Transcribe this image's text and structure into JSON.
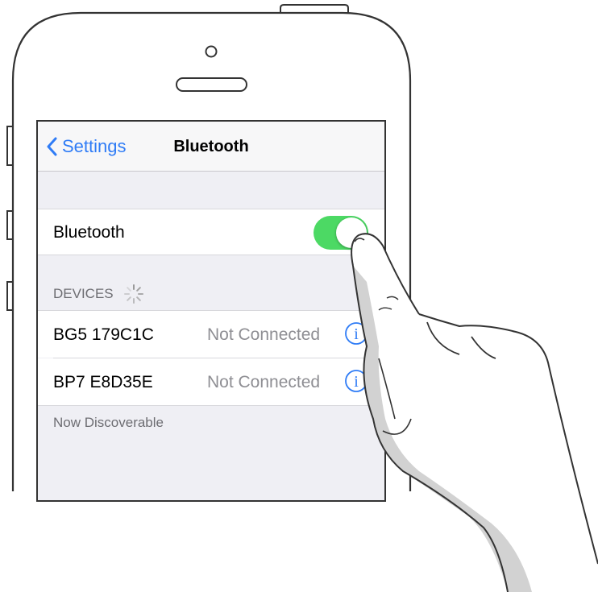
{
  "navbar": {
    "back_label": "Settings",
    "title": "Bluetooth"
  },
  "bluetooth_cell": {
    "label": "Bluetooth",
    "toggle_on": true
  },
  "devices": {
    "header": "DEVICES",
    "items": [
      {
        "name": "BG5 179C1C",
        "status": "Not Connected",
        "info_icon": "info-icon"
      },
      {
        "name": "BP7 E8D35E",
        "status": "Not Connected",
        "info_icon": "info-icon"
      }
    ],
    "footer": "Now Discoverable"
  },
  "colors": {
    "accent": "#2f7cf6",
    "toggle_on": "#4cd964",
    "background": "#efeff4"
  }
}
